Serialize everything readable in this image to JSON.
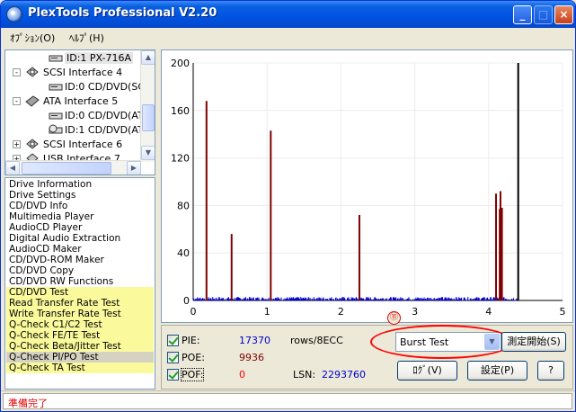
{
  "window": {
    "title": "PlexTools Professional V2.20"
  },
  "menu": {
    "options": "ｵﾌﾟｼｮﾝ(O)",
    "help": "ﾍﾙﾌﾟ(H)"
  },
  "tree": {
    "items": [
      {
        "label": "ID:1  PX-716A",
        "icon": "cd-drive-icon",
        "selected": true
      },
      {
        "label": "SCSI Interface 4",
        "icon": "scsi-interface-icon",
        "toggle": "-"
      },
      {
        "label": "ID:0  CD/DVD(SC",
        "icon": "cd-drive-icon"
      },
      {
        "label": "ATA Interface 5",
        "icon": "ata-interface-icon",
        "toggle": "-"
      },
      {
        "label": "ID:0  CD/DVD(AT.",
        "icon": "cd-drive-icon"
      },
      {
        "label": "ID:1  CD/DVD(AT.",
        "icon": "cd-drive-icon"
      },
      {
        "label": "SCSI Interface 6",
        "icon": "scsi-interface-icon",
        "toggle": "+"
      },
      {
        "label": "USB Interface 7",
        "icon": "usb-interface-icon",
        "toggle": "+"
      }
    ]
  },
  "functions": [
    {
      "label": "Drive Information",
      "hl": false
    },
    {
      "label": "Drive Settings",
      "hl": false
    },
    {
      "label": "CD/DVD Info",
      "hl": false
    },
    {
      "label": "Multimedia Player",
      "hl": false
    },
    {
      "label": "AudioCD Player",
      "hl": false
    },
    {
      "label": "Digital Audio Extraction",
      "hl": false
    },
    {
      "label": "AudioCD Maker",
      "hl": false
    },
    {
      "label": "CD/DVD-ROM Maker",
      "hl": false
    },
    {
      "label": "CD/DVD Copy",
      "hl": false
    },
    {
      "label": "CD/DVD RW Functions",
      "hl": false
    },
    {
      "label": "CD/DVD Test",
      "hl": true
    },
    {
      "label": "Read Transfer Rate Test",
      "hl": true
    },
    {
      "label": "Write Transfer Rate Test",
      "hl": true
    },
    {
      "label": "Q-Check C1/C2 Test",
      "hl": true
    },
    {
      "label": "Q-Check FE/TE Test",
      "hl": true
    },
    {
      "label": "Q-Check Beta/Jitter Test",
      "hl": true
    },
    {
      "label": "Q-Check PI/PO Test",
      "hl": true,
      "selected": true
    },
    {
      "label": "Q-Check TA Test",
      "hl": true
    }
  ],
  "chart_data": {
    "type": "bar",
    "xlim": [
      0,
      5
    ],
    "ylim": [
      0,
      200
    ],
    "x_ticks": [
      "0",
      "1",
      "2",
      "3",
      "4",
      "5"
    ],
    "y_ticks": [
      "0",
      "40",
      "80",
      "120",
      "160",
      "200"
    ],
    "grid": true,
    "series": [
      {
        "color": "#800000",
        "points": [
          [
            0.18,
            168
          ],
          [
            0.52,
            56
          ],
          [
            1.05,
            143
          ],
          [
            2.25,
            72
          ],
          [
            4.1,
            90
          ],
          [
            4.15,
            77
          ],
          [
            4.16,
            92
          ],
          [
            4.18,
            78
          ],
          [
            4.4,
            200
          ]
        ]
      },
      {
        "color": "#0000cc",
        "baseline_max": 4.4,
        "baseline_level": 3
      }
    ]
  },
  "stats": {
    "pie_label": "PIE:",
    "pie_value": "17370",
    "pie_unit": "rows/8ECC",
    "poe_label": "POE:",
    "poe_value": "9936",
    "pof_label": "POF:",
    "pof_value": "0",
    "lsn_label": "LSN:",
    "lsn_value": "2293760"
  },
  "controls": {
    "test_select": "Burst Test",
    "start_button": "測定開始(S)",
    "log_button": "ﾛｸﾞ(V)",
    "settings_button": "設定(P)",
    "help_button": "?"
  },
  "annotation": {
    "number": "⑪"
  },
  "status": {
    "text": "準備完了"
  },
  "colors": {
    "title_bar": "#0054e3",
    "highlight": "#fafa9c",
    "annotation": "#ff0000",
    "pie_color": "#0000cc",
    "poe_color": "#800000",
    "pof_color": "#ff0000"
  }
}
